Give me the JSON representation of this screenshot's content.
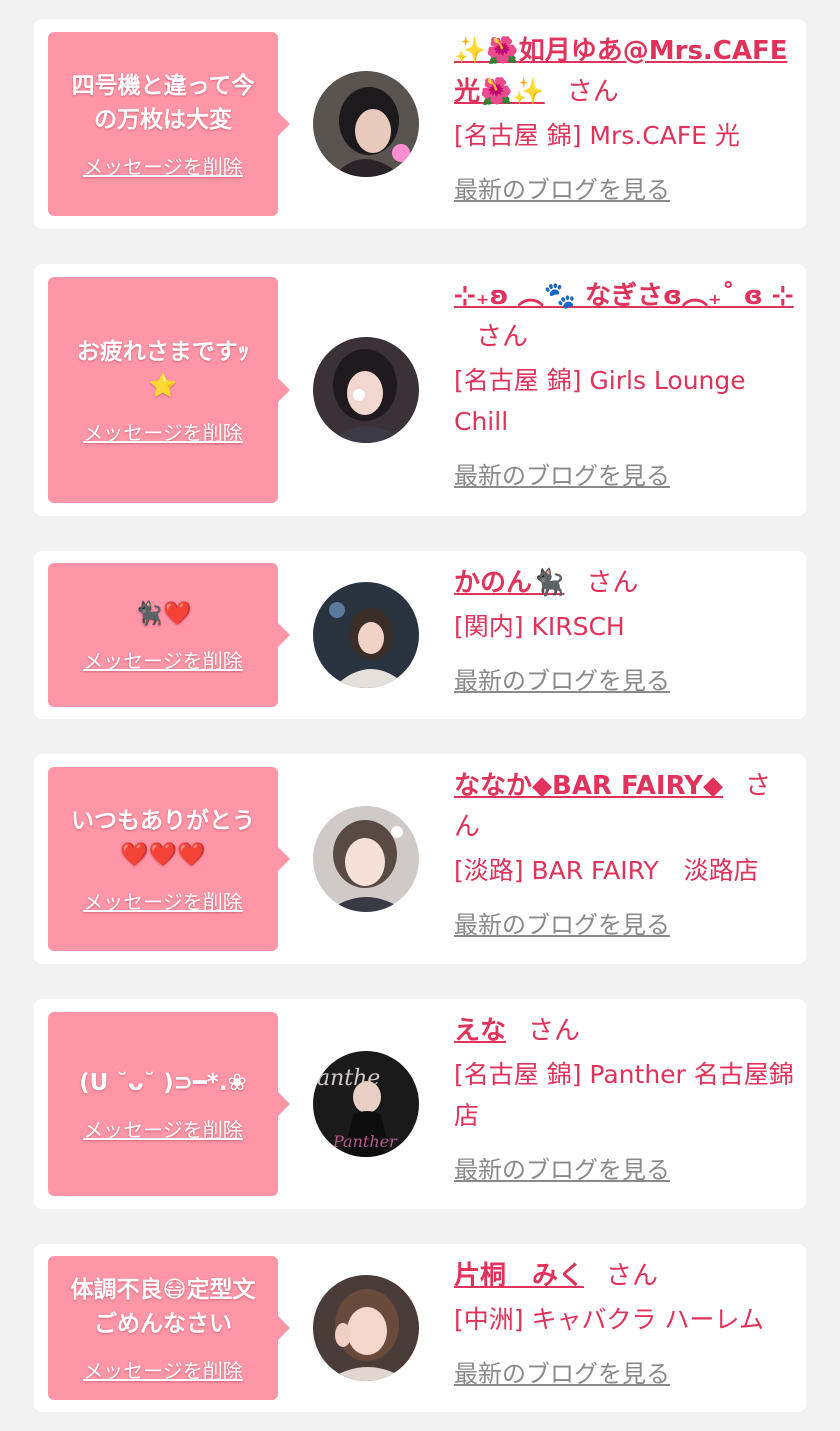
{
  "delete_label": "メッセージを削除",
  "san_label": "さん",
  "blog_label": "最新のブログを見る",
  "colors": {
    "background": "#f2f2f2",
    "card": "#ffffff",
    "bubble": "#ff96a8",
    "accent": "#e0325a",
    "link_gray": "#8a8a8a"
  },
  "messages": [
    {
      "message": "四号機と違って今\nの万枚は大変",
      "name": "✨🌺如月ゆあ@Mrs.CAFE光🌺✨",
      "shop": "[名古屋 錦] Mrs.CAFE 光",
      "avatar_icon": "avatar-photo"
    },
    {
      "message": "お疲れさまですｯ\n⭐",
      "name": "⊹₊ʚ ︵🐾 なぎさɞ︵₊˚ ɞ ⊹",
      "shop": "[名古屋 錦] Girls Lounge Chill",
      "avatar_icon": "avatar-photo"
    },
    {
      "message": "🐈‍⬛❤️",
      "name": "かのん🐈‍⬛",
      "shop": "[関内] KIRSCH",
      "avatar_icon": "avatar-photo"
    },
    {
      "message": "いつもありがとう\n❤️❤️❤️",
      "name": "ななか◆BAR FAIRY◆",
      "shop": "[淡路] BAR FAIRY　淡路店",
      "avatar_icon": "avatar-photo"
    },
    {
      "message": "(U ˘ᴗ˘ )⊃━*.❀",
      "name": "えな",
      "shop": "[名古屋 錦] Panther 名古屋錦店",
      "avatar_icon": "avatar-photo"
    },
    {
      "message": "体調不良😷定型文\nごめんなさい",
      "name": "片桐　みく",
      "shop": "[中洲] キャバクラ ハーレム",
      "avatar_icon": "avatar-photo"
    }
  ]
}
